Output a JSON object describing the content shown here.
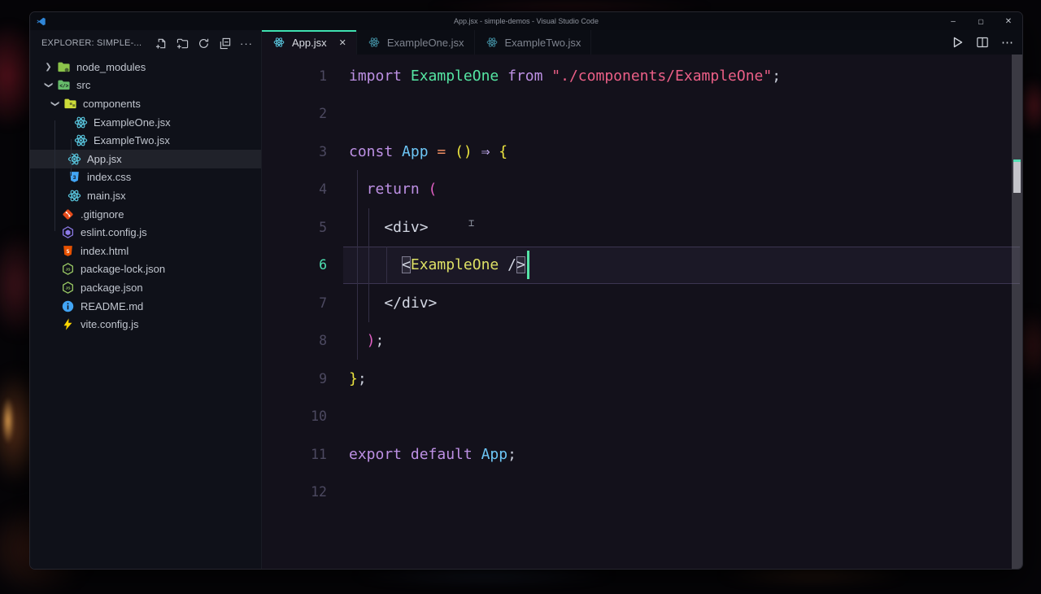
{
  "window": {
    "title": "App.jsx - simple-demos - Visual Studio Code",
    "logo_icon": "vscode-logo-icon",
    "controls": [
      {
        "name": "minimize-button",
        "glyph": "–"
      },
      {
        "name": "maximize-button",
        "glyph": "▢"
      },
      {
        "name": "close-button",
        "glyph": "✕"
      }
    ]
  },
  "explorer": {
    "header": "EXPLORER: SIMPLE-...",
    "action_icons": [
      "new-file-icon",
      "new-folder-icon",
      "refresh-icon",
      "collapse-all-icon",
      "more-actions-icon"
    ],
    "tree": [
      {
        "label": "node_modules",
        "icon": "folder-node-icon",
        "kind": "folder",
        "level": 0,
        "expanded": false,
        "selected": false
      },
      {
        "label": "src",
        "icon": "folder-src-icon",
        "kind": "folder",
        "level": 0,
        "expanded": true,
        "selected": false
      },
      {
        "label": "components",
        "icon": "folder-components-icon",
        "kind": "folder",
        "level": 1,
        "expanded": true,
        "selected": false
      },
      {
        "label": "ExampleOne.jsx",
        "icon": "react-icon",
        "kind": "file",
        "level": 2,
        "selected": false
      },
      {
        "label": "ExampleTwo.jsx",
        "icon": "react-icon",
        "kind": "file",
        "level": 2,
        "selected": false
      },
      {
        "label": "App.jsx",
        "icon": "react-icon",
        "kind": "file",
        "level": 1,
        "selected": true
      },
      {
        "label": "index.css",
        "icon": "css-icon",
        "kind": "file",
        "level": 1,
        "selected": false
      },
      {
        "label": "main.jsx",
        "icon": "react-icon",
        "kind": "file",
        "level": 1,
        "selected": false
      },
      {
        "label": ".gitignore",
        "icon": "git-icon",
        "kind": "file",
        "level": 0,
        "selected": false
      },
      {
        "label": "eslint.config.js",
        "icon": "eslint-icon",
        "kind": "file",
        "level": 0,
        "selected": false
      },
      {
        "label": "index.html",
        "icon": "html-icon",
        "kind": "file",
        "level": 0,
        "selected": false
      },
      {
        "label": "package-lock.json",
        "icon": "node-json-icon",
        "kind": "file",
        "level": 0,
        "selected": false
      },
      {
        "label": "package.json",
        "icon": "node-json-icon",
        "kind": "file",
        "level": 0,
        "selected": false
      },
      {
        "label": "README.md",
        "icon": "readme-icon",
        "kind": "file",
        "level": 0,
        "selected": false
      },
      {
        "label": "vite.config.js",
        "icon": "vite-icon",
        "kind": "file",
        "level": 0,
        "selected": false
      }
    ]
  },
  "tabs": [
    {
      "label": "App.jsx",
      "icon": "react-icon",
      "active": true,
      "close_glyph": "✕"
    },
    {
      "label": "ExampleOne.jsx",
      "icon": "react-icon",
      "active": false
    },
    {
      "label": "ExampleTwo.jsx",
      "icon": "react-icon",
      "active": false
    }
  ],
  "editor_actions": {
    "icons": [
      "run-icon",
      "split-editor-icon"
    ],
    "more_glyph": "⋯"
  },
  "code": {
    "lines": [
      {
        "n": "1",
        "tokens": [
          {
            "t": "import",
            "c": "kw"
          },
          {
            "t": " ",
            "c": "pl"
          },
          {
            "t": "ExampleOne",
            "c": "comp"
          },
          {
            "t": " ",
            "c": "pl"
          },
          {
            "t": "from",
            "c": "kw"
          },
          {
            "t": " ",
            "c": "pl"
          },
          {
            "t": "\"./components/ExampleOne\"",
            "c": "str"
          },
          {
            "t": ";",
            "c": "pl"
          }
        ]
      },
      {
        "n": "2",
        "tokens": []
      },
      {
        "n": "3",
        "tokens": [
          {
            "t": "const",
            "c": "kw"
          },
          {
            "t": " App",
            "c": "var"
          },
          {
            "t": " =",
            "c": "op"
          },
          {
            "t": " ()",
            "c": "b1"
          },
          {
            "t": " ⇒",
            "c": "arrow"
          },
          {
            "t": " {",
            "c": "b1"
          }
        ]
      },
      {
        "n": "4",
        "tokens": [
          {
            "t": "  return",
            "c": "kw"
          },
          {
            "t": " (",
            "c": "b2"
          }
        ]
      },
      {
        "n": "5",
        "tokens": [
          {
            "t": "    <div>",
            "c": "tag"
          }
        ]
      },
      {
        "n": "6",
        "current": true,
        "tokens": [
          {
            "t": "      ",
            "c": "pl"
          },
          {
            "t": "<",
            "c": "tag",
            "bm": true
          },
          {
            "t": "ExampleOne",
            "c": "comp2"
          },
          {
            "t": " /",
            "c": "tag"
          },
          {
            "t": ">",
            "c": "tag",
            "bm": true
          },
          {
            "cursor": true
          }
        ]
      },
      {
        "n": "7",
        "tokens": [
          {
            "t": "    </div>",
            "c": "tag"
          }
        ]
      },
      {
        "n": "8",
        "tokens": [
          {
            "t": "  )",
            "c": "b2"
          },
          {
            "t": ";",
            "c": "pl"
          }
        ]
      },
      {
        "n": "9",
        "tokens": [
          {
            "t": "}",
            "c": "b1"
          },
          {
            "t": ";",
            "c": "pl"
          }
        ]
      },
      {
        "n": "10",
        "tokens": []
      },
      {
        "n": "11",
        "tokens": [
          {
            "t": "export",
            "c": "kw"
          },
          {
            "t": " default",
            "c": "kw"
          },
          {
            "t": " App",
            "c": "var"
          },
          {
            "t": ";",
            "c": "pl"
          }
        ]
      },
      {
        "n": "12",
        "tokens": []
      }
    ]
  },
  "colors": {
    "accent_teal": "#3fe0b0",
    "editor_bg": "#13111b",
    "sidebar_bg": "#0f1119",
    "keyword": "#bd90e4",
    "string": "#ec5f87",
    "component_green": "#55e6a3",
    "component_yellow": "#dde065",
    "variable_blue": "#6dc6f6",
    "bracket_yellow": "#ece43f",
    "bracket_magenta": "#e05fc3",
    "react_icon": "#58c4dc"
  }
}
